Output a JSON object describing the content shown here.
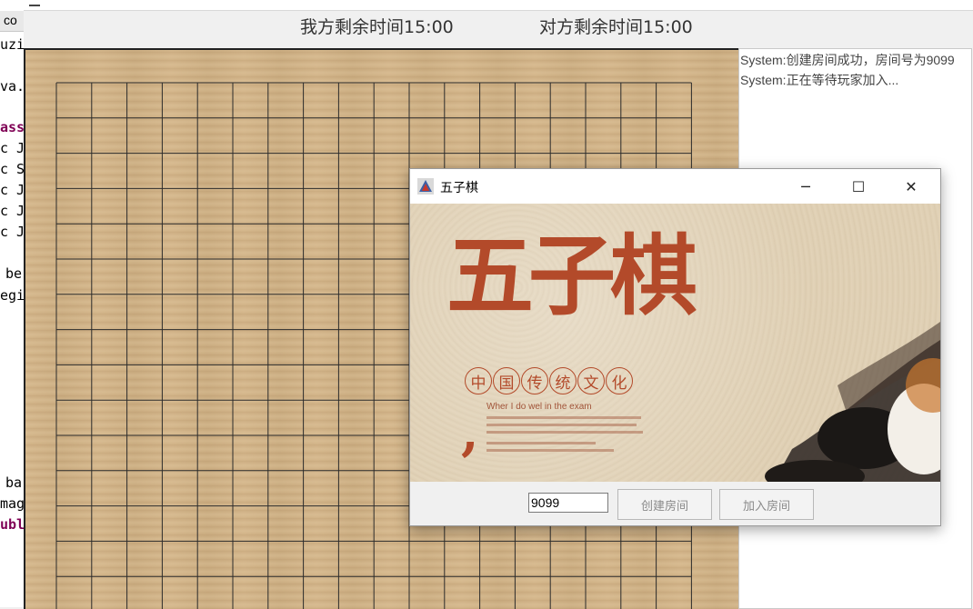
{
  "ide": {
    "lines": [
      "co",
      "uzi",
      "va.",
      "ass",
      "c J",
      "c S",
      "c J",
      "c J",
      "c J",
      "be",
      "egi",
      "ba",
      "mag",
      "ubl"
    ]
  },
  "game": {
    "my_time": "我方剩余时间15:00",
    "opponent_time": "对方剩余时间15:00"
  },
  "chat": {
    "messages": [
      "System:创建房间成功，房间号为9099",
      "System:正在等待玩家加入..."
    ]
  },
  "dialog": {
    "title": "五子棋",
    "minimize_glyph": "─",
    "maximize_glyph": "☐",
    "close_glyph": "✕",
    "poster": {
      "big_title": "五子棋",
      "circle_chars": [
        "中",
        "国",
        "传",
        "统",
        "文",
        "化"
      ],
      "quote_mark": ",",
      "english": "Wher I do wel in the exam"
    },
    "room_input_value": "9099",
    "create_button": "创建房间",
    "join_button": "加入房间"
  },
  "colors": {
    "board": "#d2b386",
    "poster_red": "#b34a2a"
  }
}
